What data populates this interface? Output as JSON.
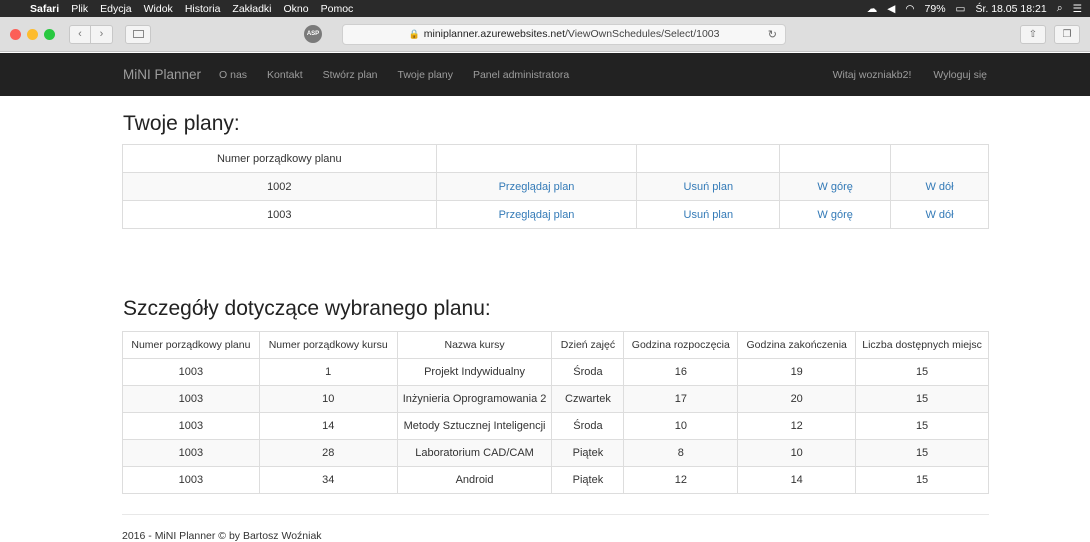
{
  "os_menu": {
    "app": "Safari",
    "items": [
      "Plik",
      "Edycja",
      "Widok",
      "Historia",
      "Zakładki",
      "Okno",
      "Pomoc"
    ],
    "battery": "79%",
    "clock": "Śr. 18.05  18:21"
  },
  "browser": {
    "url_domain": "miniplanner.azurewebsites.net",
    "url_path": "/ViewOwnSchedules/Select/1003",
    "badge": "ASP"
  },
  "navbar": {
    "brand": "MiNI Planner",
    "links": [
      "O nas",
      "Kontakt",
      "Stwórz plan",
      "Twoje plany",
      "Panel administratora"
    ],
    "greeting": "Witaj wozniakb2!",
    "logout": "Wyloguj się"
  },
  "plans": {
    "heading": "Twoje plany:",
    "header": "Numer porządkowy planu",
    "rows": [
      {
        "id": "1002",
        "view": "Przeglądaj plan",
        "delete": "Usuń plan",
        "up": "W górę",
        "down": "W dół"
      },
      {
        "id": "1003",
        "view": "Przeglądaj plan",
        "delete": "Usuń plan",
        "up": "W górę",
        "down": "W dół"
      }
    ]
  },
  "details": {
    "heading": "Szczegóły dotyczące wybranego planu:",
    "headers": [
      "Numer porządkowy planu",
      "Numer porządkowy kursu",
      "Nazwa kursy",
      "Dzień zajęć",
      "Godzina rozpoczęcia",
      "Godzina zakończenia",
      "Liczba dostępnych miejsc"
    ],
    "rows": [
      [
        "1003",
        "1",
        "Projekt Indywidualny",
        "Środa",
        "16",
        "19",
        "15"
      ],
      [
        "1003",
        "10",
        "Inżynieria Oprogramowania 2",
        "Czwartek",
        "17",
        "20",
        "15"
      ],
      [
        "1003",
        "14",
        "Metody Sztucznej Inteligencji",
        "Środa",
        "10",
        "12",
        "15"
      ],
      [
        "1003",
        "28",
        "Laboratorium CAD/CAM",
        "Piątek",
        "8",
        "10",
        "15"
      ],
      [
        "1003",
        "34",
        "Android",
        "Piątek",
        "12",
        "14",
        "15"
      ]
    ]
  },
  "footer": "2016 - MiNI Planner © by Bartosz Woźniak",
  "colors": {
    "link": "#337ab7",
    "navbar": "#222222",
    "nav_text": "#9d9d9d"
  }
}
